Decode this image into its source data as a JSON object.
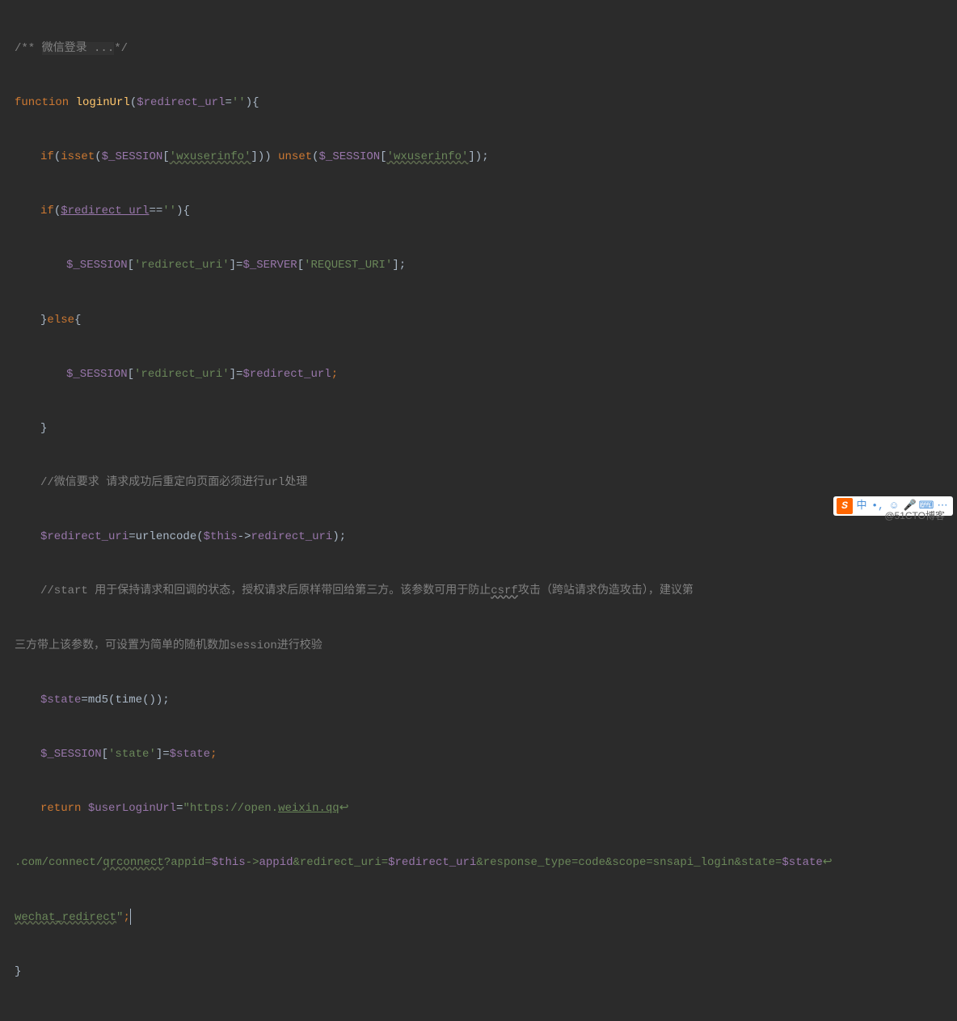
{
  "code": {
    "l1": {
      "comment_open": "/** ",
      "comment_text": "微信登录 ...",
      "comment_close": "*/"
    },
    "l2": {
      "fn_keyword": "function",
      "fn_name": " loginUrl",
      "param_open": "(",
      "param_var": "$redirect_url",
      "param_eq": "=",
      "param_default": "''",
      "param_close": "){"
    },
    "l3": {
      "if_kw": "if",
      "open": "(",
      "isset_kw": "isset",
      "isset_open": "(",
      "session": "$_SESSION",
      "bracket": "[",
      "key": "'wxuserinfo'",
      "close_br": "])) ",
      "unset_kw": "unset",
      "unset_open": "(",
      "session2": "$_SESSION",
      "bracket2": "[",
      "key2": "'wxuserinfo'",
      "close2": "]);"
    },
    "l4": {
      "if_kw": "if",
      "open": "(",
      "var": "$redirect_url",
      "eq": "==",
      "empty": "''",
      "close": "){"
    },
    "l5": {
      "session": "$_SESSION",
      "open": "[",
      "key": "'redirect_uri'",
      "close": "]=",
      "server": "$_SERVER",
      "open2": "[",
      "key2": "'REQUEST_URI'",
      "close2": "];"
    },
    "l6": {
      "brace": "}",
      "else_kw": "else",
      "brace2": "{"
    },
    "l7": {
      "session": "$_SESSION",
      "open": "[",
      "key": "'redirect_uri'",
      "close": "]=",
      "var": "$redirect_url",
      "semi": ";"
    },
    "l8": {
      "brace": "}"
    },
    "l9": {
      "comment": "//微信要求 请求成功后重定向页面必须进行url处理"
    },
    "l10": {
      "var": "$redirect_uri",
      "eq": "=",
      "fn": "urlencode",
      "open": "(",
      "this": "$this",
      "arrow": "->",
      "prop": "redirect_uri",
      "close": ");"
    },
    "l11": {
      "comment_pre": "//start 用于保持请求和回调的状态，授权请求后原样带回给第三方。该参数可用于防止",
      "csrf": "csrf",
      "comment_post": "攻击（跨站请求伪造攻击），建议第"
    },
    "l12": {
      "comment": "三方带上该参数，可设置为简单的随机数加session进行校验"
    },
    "l13": {
      "var": "$state",
      "eq": "=",
      "fn": "md5",
      "open": "(",
      "time_fn": "time",
      "time_parens": "()",
      "close": ");"
    },
    "l14": {
      "session": "$_SESSION",
      "open": "[",
      "key": "'state'",
      "close": "]=",
      "var": "$state",
      "semi": ";"
    },
    "l15": {
      "return_kw": "return",
      "var": " $userLoginUrl",
      "eq": "=",
      "str_open": "\"",
      "url_pre": "https://open.",
      "url_link": "weixin.qq",
      "wrap1": "↩"
    },
    "l16": {
      "url": ".com/connect/",
      "qrconnect": "qrconnect",
      "query": "?appid=",
      "this": "$this",
      "arrow": "->",
      "appid": "appid",
      "redir": "&redirect_uri=",
      "redir_var": "$redirect_uri",
      "resp": "&response_type=code&scope=snsapi_login&state=",
      "state_var": "$state",
      "wrap2": "↩"
    },
    "l17": {
      "wechat": "wechat_redirect",
      "str_close": "\"",
      "semi": ";"
    },
    "l18": {
      "brace": "}"
    }
  },
  "ime": {
    "logo": "S",
    "zh": "中",
    "dot": "•,",
    "face": "☺",
    "mic": "🎤",
    "kb": "⌨",
    "more": "⋯"
  },
  "watermark": "@51CTO博客"
}
